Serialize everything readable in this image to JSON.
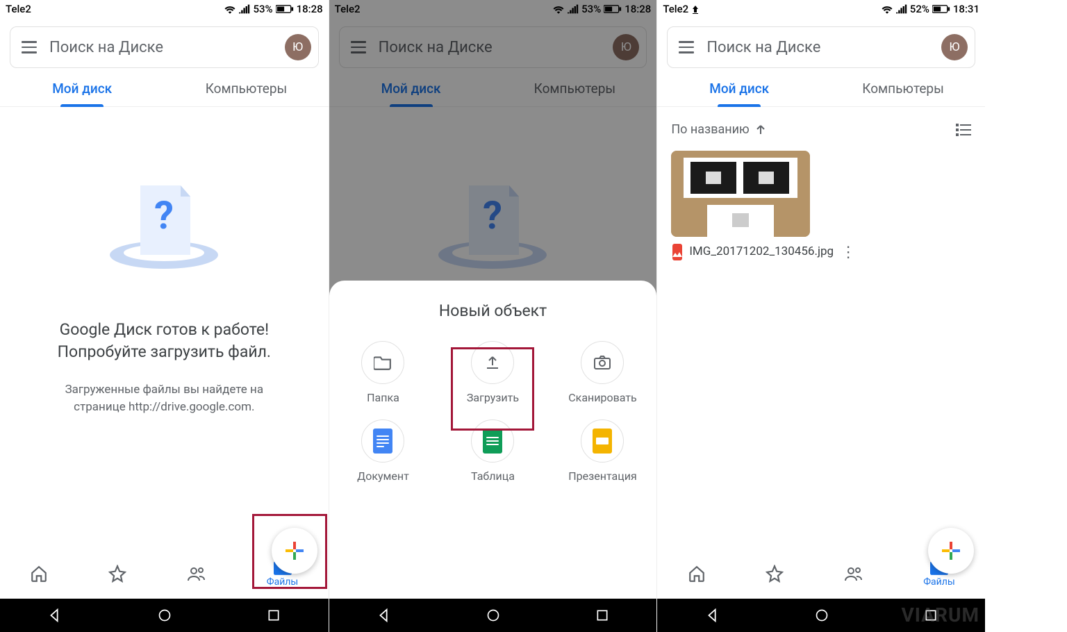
{
  "statusbar": {
    "carrier": "Tele2",
    "battery1": "53%",
    "time1": "18:28",
    "battery3": "52%",
    "time3": "18:31"
  },
  "search": {
    "placeholder": "Поиск на Диске",
    "avatar_initial": "Ю"
  },
  "tabs": {
    "drive": "Мой диск",
    "computers": "Компьютеры"
  },
  "empty": {
    "title_line1": "Google Диск готов к работе!",
    "title_line2": "Попробуйте загрузить файл.",
    "sub_line1": "Загруженные файлы вы найдете на",
    "sub_line2": "странице http://drive.google.com."
  },
  "bottombar": {
    "files": "Файлы"
  },
  "sheet": {
    "title": "Новый объект",
    "items": [
      {
        "label": "Папка"
      },
      {
        "label": "Загрузить"
      },
      {
        "label": "Сканировать"
      },
      {
        "label": "Документ"
      },
      {
        "label": "Таблица"
      },
      {
        "label": "Презентация"
      }
    ]
  },
  "pane3": {
    "sort_label": "По названию",
    "file_name": "IMG_20171202_130456.jpg"
  },
  "watermark": "VIARUM"
}
